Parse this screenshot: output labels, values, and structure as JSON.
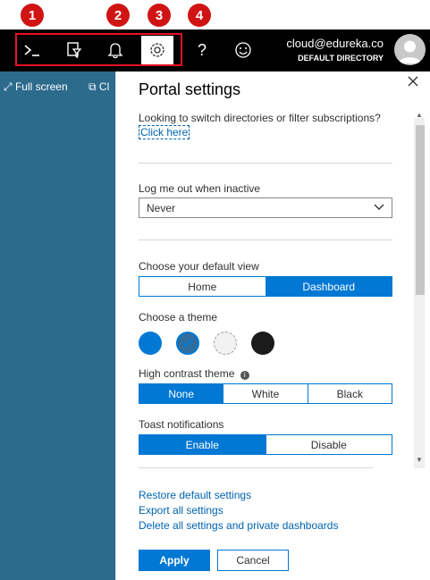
{
  "badges": [
    "1",
    "2",
    "3",
    "4"
  ],
  "topbar": {
    "icons": [
      "cloud-shell-icon",
      "directory-filter-icon",
      "notifications-icon",
      "settings-icon",
      "help-icon",
      "feedback-icon"
    ],
    "account": {
      "email": "cloud@edureka.co",
      "directory": "DEFAULT DIRECTORY"
    }
  },
  "left_pane": {
    "fullscreen_label": "Full screen",
    "clone_label": "Cl"
  },
  "panel": {
    "title": "Portal settings",
    "switch_text": "Looking to switch directories or filter subscriptions?",
    "click_here": "Click here",
    "logout_label": "Log me out when inactive",
    "logout_value": "Never",
    "default_view_label": "Choose your default view",
    "default_view_options": [
      "Home",
      "Dashboard"
    ],
    "default_view_selected": "Dashboard",
    "theme_label": "Choose a theme",
    "themes": [
      {
        "name": "blue",
        "color": "#0078d4"
      },
      {
        "name": "azure",
        "color": "#2e6e9e"
      },
      {
        "name": "light",
        "color": "#f2f2f2"
      },
      {
        "name": "dark",
        "color": "#1b1b1b"
      }
    ],
    "high_contrast_label": "High contrast theme",
    "high_contrast_options": [
      "None",
      "White",
      "Black"
    ],
    "high_contrast_selected": "None",
    "toast_label": "Toast notifications",
    "toast_options": [
      "Enable",
      "Disable"
    ],
    "toast_selected": "Enable",
    "restore_link": "Restore default settings",
    "export_link": "Export all settings",
    "delete_link": "Delete all settings and private dashboards",
    "apply_label": "Apply",
    "cancel_label": "Cancel"
  },
  "colors": {
    "accent": "#0078d4",
    "topbar": "#000000",
    "left_pane": "#2d6b8c",
    "badge": "#d01414"
  }
}
